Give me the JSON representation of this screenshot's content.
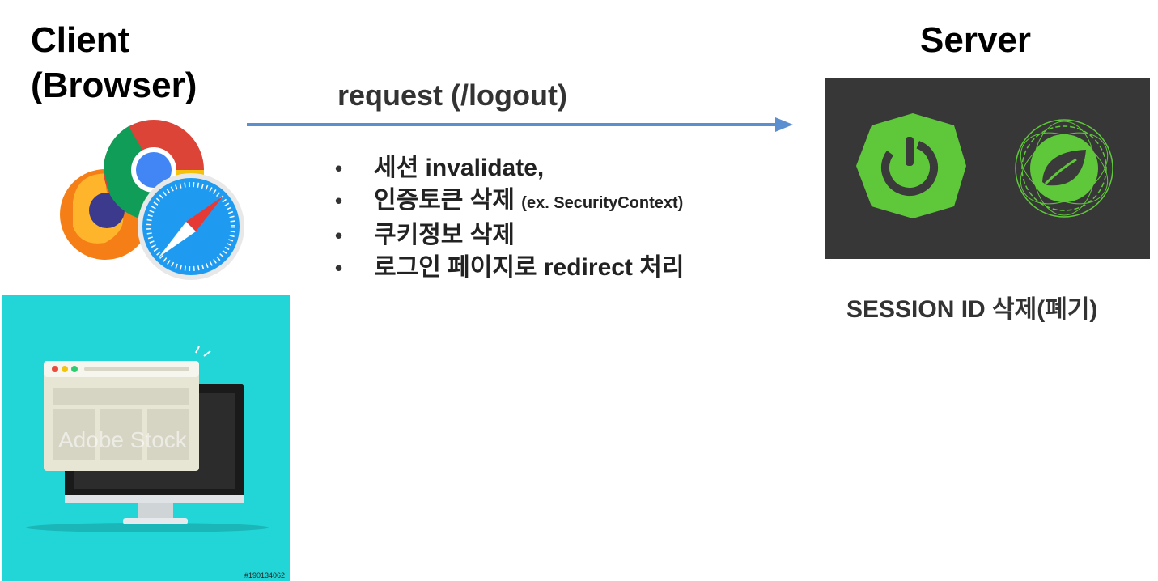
{
  "client": {
    "title_line1": "Client",
    "title_line2": "(Browser)"
  },
  "server": {
    "title": "Server",
    "session_note": "SESSION ID 삭제(폐기)"
  },
  "request": {
    "label": "request (/logout)"
  },
  "steps": [
    {
      "text": "세션 invalidate,"
    },
    {
      "text": "인증토큰 삭제 ",
      "note": "(ex. SecurityContext)"
    },
    {
      "text": "쿠키정보 삭제"
    },
    {
      "text": "로그인 페이지로 redirect 처리"
    }
  ],
  "stock_image": {
    "watermark": "Adobe Stock",
    "id": "#190134062"
  },
  "icons": [
    "firefox-icon",
    "chrome-icon",
    "safari-icon",
    "spring-boot-icon",
    "spring-leaf-icon",
    "computer-illustration"
  ],
  "colors": {
    "arrow": "#5b8fd0",
    "spring_green": "#5fc83a",
    "server_bg": "#373737",
    "stock_bg": "#22d5d7"
  }
}
